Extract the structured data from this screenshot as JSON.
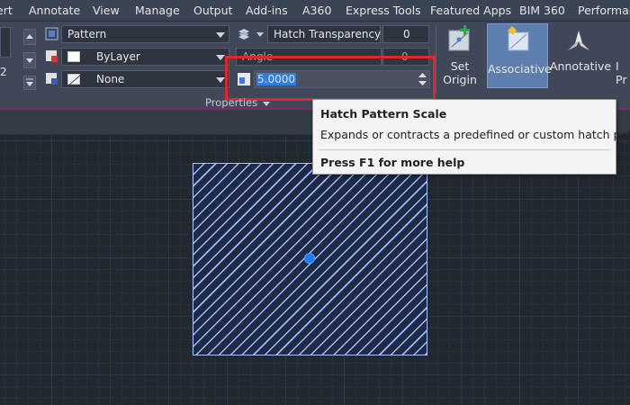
{
  "menu": {
    "tabs": [
      "ert",
      "Annotate",
      "View",
      "Manage",
      "Output",
      "Add-ins",
      "A360",
      "Express Tools",
      "Featured Apps",
      "BIM 360",
      "Performan"
    ]
  },
  "ribbon": {
    "pattern_combo": "Pattern",
    "color_combo": "ByLayer",
    "bg_combo": "None",
    "transparency_label": "Hatch Transparency",
    "transparency_value": "0",
    "angle_label": "Angle",
    "angle_value": "0",
    "scale_value": "5.0000",
    "left_number": "2",
    "set_origin_label": "Set\nOrigin",
    "associative_label": "Associative",
    "annotative_label": "Annotative",
    "cut_label": "I\nPr",
    "properties_panel_label": "Properties"
  },
  "tooltip": {
    "title": "Hatch Pattern Scale",
    "description": "Expands or contracts a predefined or custom hatch pattern",
    "help": "Press F1 for more help"
  },
  "colors": {
    "accent": "#e4262b",
    "selection": "#1e7cf0",
    "hatch": "#9fbaff"
  }
}
